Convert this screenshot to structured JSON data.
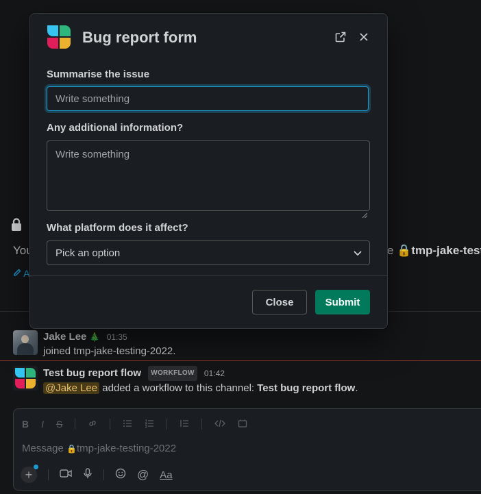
{
  "background": {
    "intro_text_fragment": "You",
    "channel_name": "tmp-jake-testi",
    "pencil_fragment": "A"
  },
  "messages": [
    {
      "author": "Jake Lee",
      "status_emoji": "🎄",
      "time": "01:35",
      "text": "joined tmp-jake-testing-2022."
    },
    {
      "author": "Test bug report flow",
      "badge": "WORKFLOW",
      "time": "01:42",
      "mention": "@Jake Lee",
      "text_pre": " added a workflow to this channel: ",
      "text_bold": "Test bug report flow",
      "text_post": "."
    }
  ],
  "composer": {
    "placeholder_prefix": "Message ",
    "channel": "tmp-jake-testing-2022",
    "format_icons": [
      "bold-icon",
      "italic-icon",
      "strikethrough-icon",
      "link-icon",
      "bulleted-list-icon",
      "numbered-list-icon",
      "blockquote-icon",
      "code-icon",
      "code-block-icon"
    ],
    "aa_label": "Aa"
  },
  "modal": {
    "title": "Bug report form",
    "fields": {
      "summary": {
        "label": "Summarise the issue",
        "placeholder": "Write something",
        "value": ""
      },
      "details": {
        "label": "Any additional information?",
        "placeholder": "Write something",
        "value": ""
      },
      "platform": {
        "label": "What platform does it affect?",
        "selected": "Pick an option"
      }
    },
    "close_label": "Close",
    "submit_label": "Submit"
  },
  "colors": {
    "accent_focus": "#1d9bd1",
    "submit_green": "#007a5a",
    "logo_blue": "#36c5f0",
    "logo_green": "#2eb67d",
    "logo_red": "#e01e5a",
    "logo_yellow": "#ecb22e"
  }
}
